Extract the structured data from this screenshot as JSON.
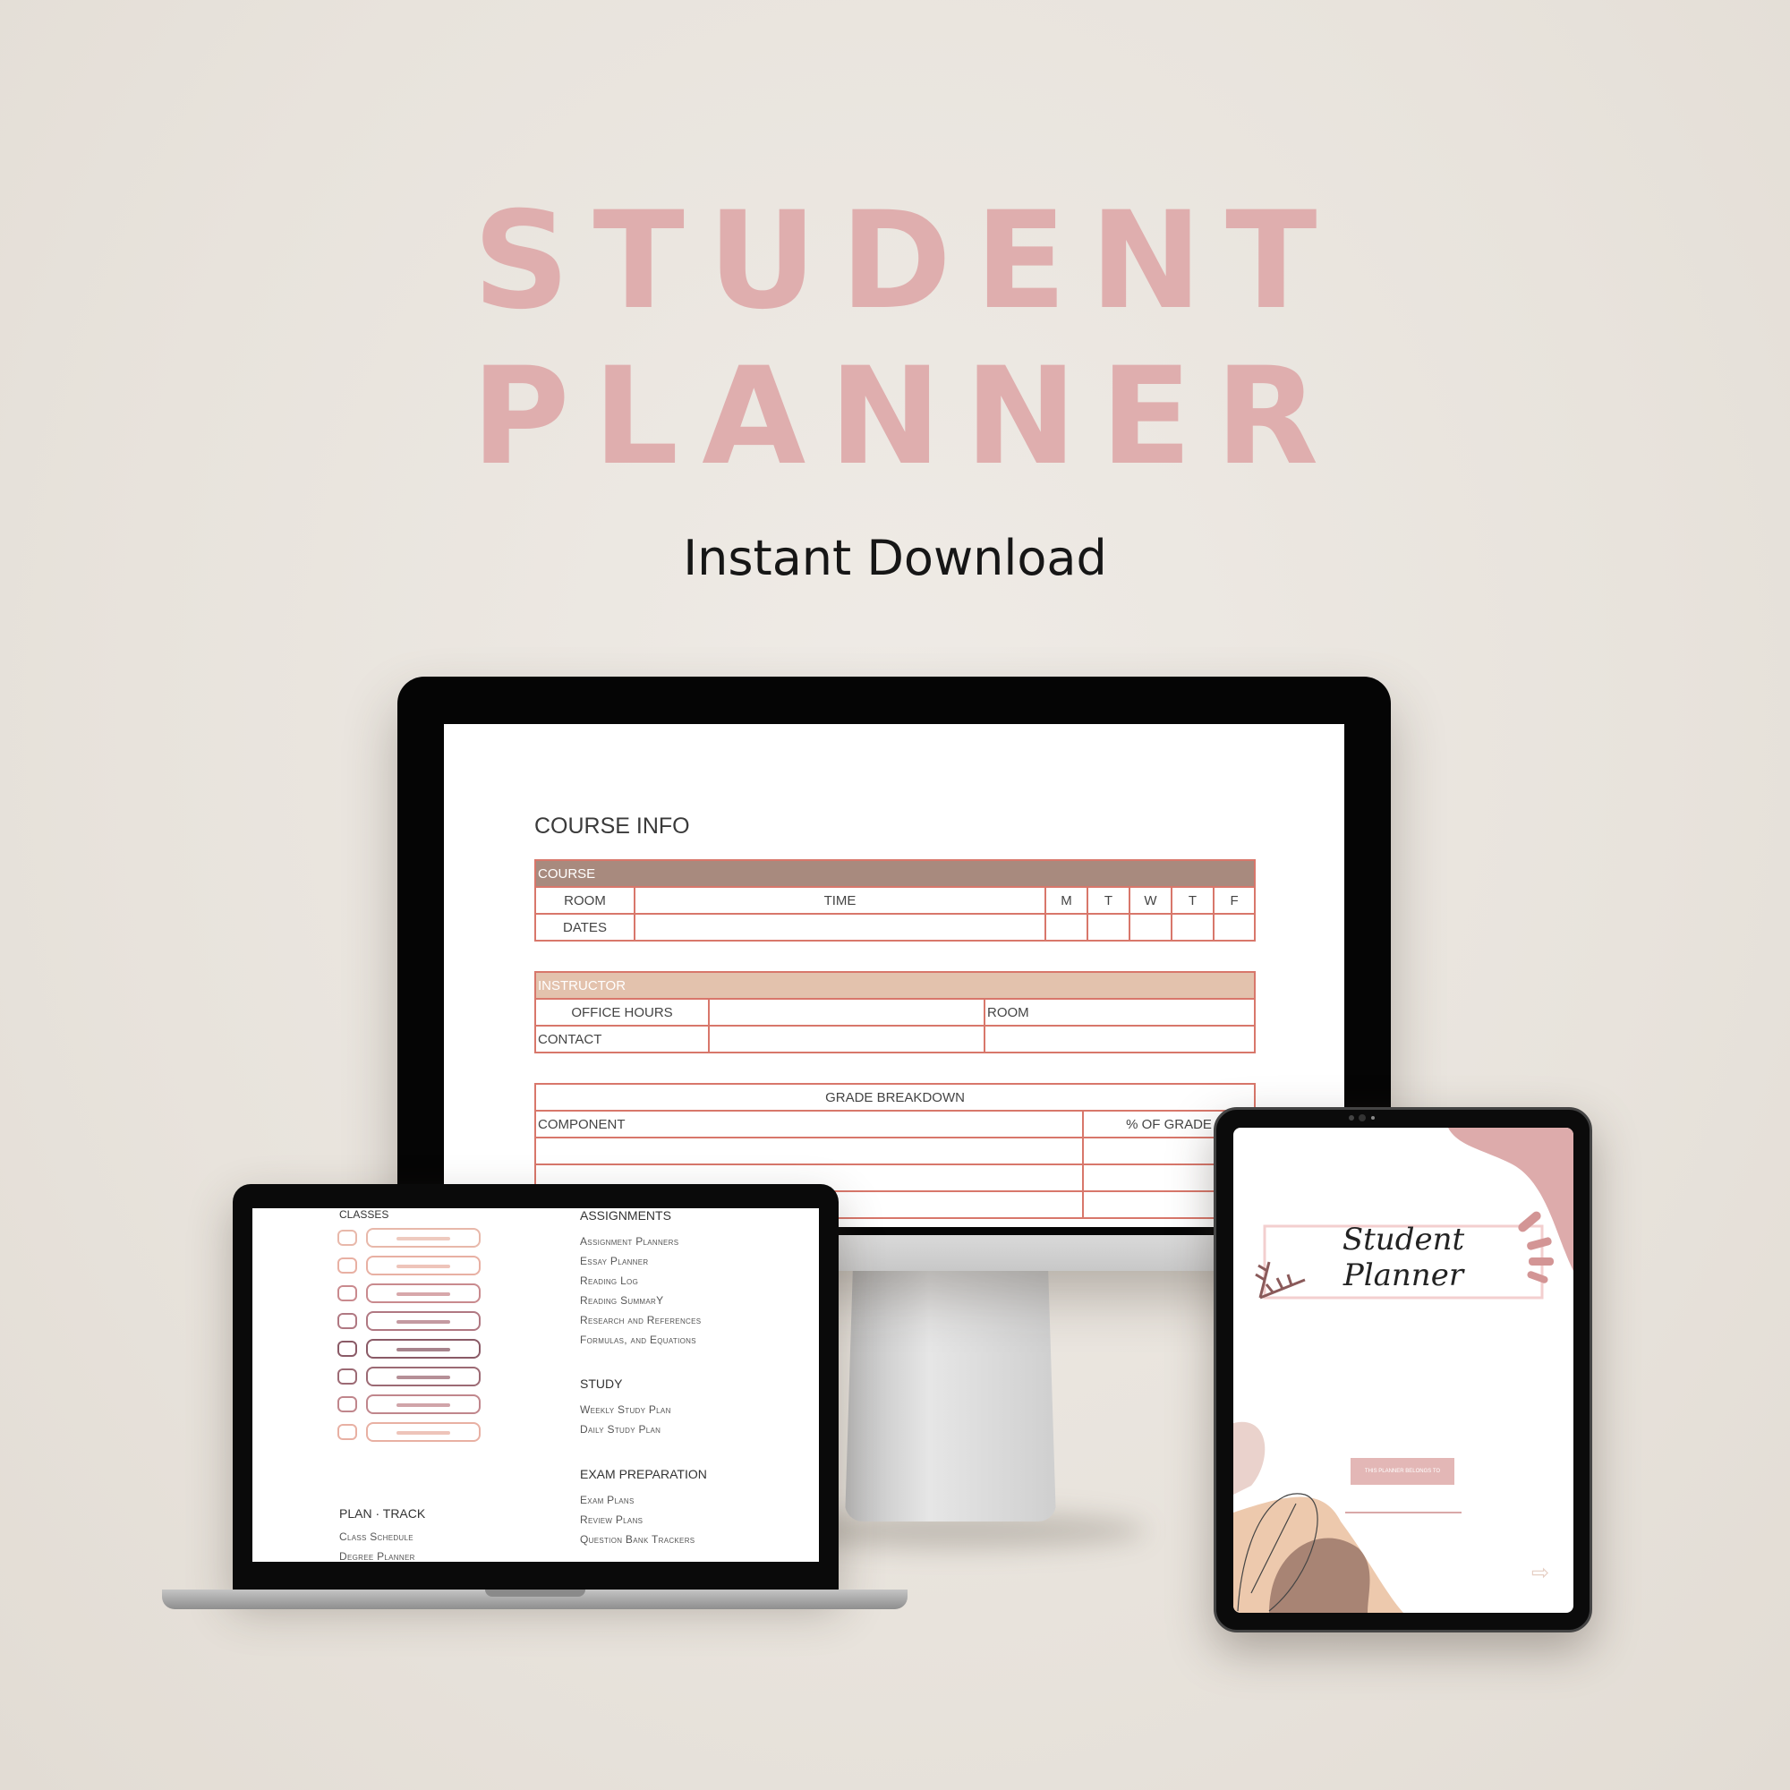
{
  "header": {
    "title": "STUDENT PLANNER",
    "subtitle": "Instant Download"
  },
  "colors": {
    "title": "#dfaeae",
    "course_header": "#a88a7e",
    "instructor_header": "#e3c2ad",
    "table_border": "#d8776b",
    "cover_pink": "#ddabab"
  },
  "monitor": {
    "title": "COURSE INFO",
    "course": {
      "header": "COURSE",
      "room": "ROOM",
      "time": "TIME",
      "days": [
        "M",
        "T",
        "W",
        "T",
        "F"
      ],
      "dates": "DATES"
    },
    "instructor": {
      "header": "INSTRUCTOR",
      "office_hours": "OFFICE HOURS",
      "room": "ROOM",
      "contact": "CONTACT"
    },
    "grade": {
      "header": "GRADE BREAKDOWN",
      "component": "COMPONENT",
      "percent": "% OF GRADE"
    }
  },
  "laptop": {
    "classes_heading": "CLASSES",
    "class_item_colors": [
      "#e8b8aa",
      "#e8b0a3",
      "#c98a8e",
      "#b07882",
      "#8a5a66",
      "#9c6a74",
      "#c0868c",
      "#e8b0a3"
    ],
    "plan_track": {
      "heading": "PLAN · TRACK",
      "items": [
        "Class Schedule",
        "Degree Planner"
      ]
    },
    "assignments": {
      "heading": "ASSIGNMENTS",
      "items": [
        "Assignment Planners",
        "Essay Planner",
        "Reading Log",
        "Reading SummarY",
        "Research and References",
        "Formulas, and Equations"
      ]
    },
    "study": {
      "heading": "STUDY",
      "items": [
        "Weekly Study Plan",
        "Daily Study Plan"
      ]
    },
    "exam": {
      "heading": "EXAM PREPARATION",
      "items": [
        "Exam Plans",
        "Review Plans",
        "Question Bank Trackers"
      ]
    }
  },
  "tablet": {
    "cover_title": "Student Planner",
    "belongs_label": "THIS PLANNER BELONGS TO",
    "next_icon": "arrow-right-icon"
  }
}
